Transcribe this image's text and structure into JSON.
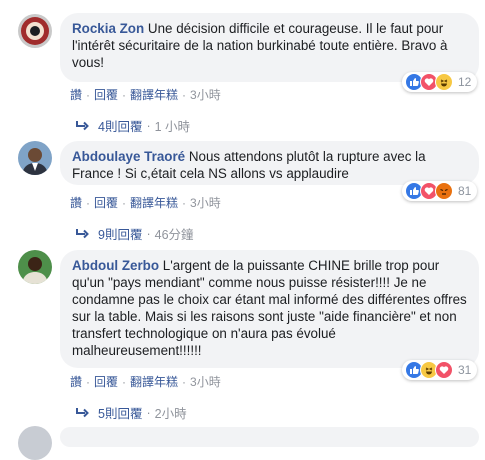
{
  "comments": [
    {
      "author": "Rockia Zon",
      "text": "Une décision difficile et courageuse. Il le faut pour l'intérêt sécuritaire de la nation burkinabé toute entière. Bravo à vous!",
      "reaction_count": "12",
      "reaction_icons": [
        "like-icon",
        "love-icon",
        "haha-icon"
      ],
      "actions": {
        "like": "讚",
        "reply": "回覆",
        "translate": "翻譯年糕",
        "time": "3小時"
      },
      "replies": {
        "label": "4則回覆",
        "time": "1 小時"
      }
    },
    {
      "author": "Abdoulaye Traoré",
      "text": "Nous attendons plutôt la rupture avec la France ! Si c,était cela NS allons vs applaudire",
      "reaction_count": "81",
      "reaction_icons": [
        "like-icon",
        "love-icon",
        "angry-icon"
      ],
      "actions": {
        "like": "讚",
        "reply": "回覆",
        "translate": "翻譯年糕",
        "time": "3小時"
      },
      "replies": {
        "label": "9則回覆",
        "time": "46分鐘"
      }
    },
    {
      "author": "Abdoul Zerbo",
      "text": "L'argent de la puissante CHINE brille trop pour qu'un \"pays mendiant\" comme nous puisse résister!!!! Je ne condamne pas le choix car étant mal informé des différentes offres sur la table. Mais si les raisons sont juste \"aide financière\" et non transfert technologique on n'aura pas évolué malheureusement!!!!!!",
      "reaction_count": "31",
      "reaction_icons": [
        "like-icon",
        "haha-icon",
        "love-icon"
      ],
      "actions": {
        "like": "讚",
        "reply": "回覆",
        "translate": "翻譯年糕",
        "time": "3小時"
      },
      "replies": {
        "label": "5則回覆",
        "time": "2小時"
      }
    }
  ],
  "colors": {
    "author": "#385898",
    "bubble": "#f2f3f5",
    "like": "#3578e5",
    "love": "#f25268",
    "haha": "#f7c843",
    "angry": "#e9710f"
  }
}
